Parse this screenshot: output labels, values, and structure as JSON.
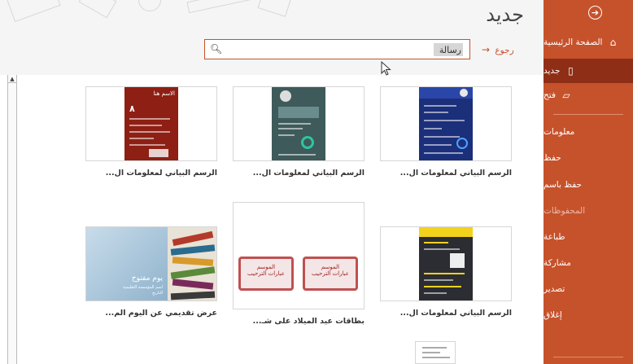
{
  "page": {
    "title": "جديد",
    "back_label": "رجوع"
  },
  "search": {
    "value": "رسالة"
  },
  "sidebar": {
    "items": [
      {
        "label": "الصفحة الرئيسية",
        "icon": "home-icon"
      },
      {
        "label": "جديد",
        "icon": "new-file-icon"
      },
      {
        "label": "فتح",
        "icon": "open-folder-icon"
      },
      {
        "label": "معلومات"
      },
      {
        "label": "حفظ"
      },
      {
        "label": "حفظ باسم"
      },
      {
        "label": "المحفوظات"
      },
      {
        "label": "طباعة"
      },
      {
        "label": "مشاركة"
      },
      {
        "label": "تصدير"
      },
      {
        "label": "إغلاق"
      }
    ]
  },
  "templates": [
    {
      "label": "الرسم البياني لمعلومات ال...",
      "thumb_text": ""
    },
    {
      "label": "الرسم البياني لمعلومات ال..."
    },
    {
      "label": "الرسم البياني لمعلومات ال...",
      "thumb_title": "الاسم هنا",
      "thumb_number": "٨"
    },
    {
      "label": "الرسم البياني لمعلومات ال..."
    },
    {
      "label": "بطاقات عيد الميلاد على شـ...",
      "card_title": "الموسم",
      "card_subtitle": "عبارات الترحيب"
    },
    {
      "label": "عرض تقديمي عن اليوم الم...",
      "slide_title": "يوم مفتوح",
      "slide_sub": "اسم المؤسسة التعليمية",
      "slide_sub2": "التاريخ"
    }
  ],
  "colors": {
    "accent": "#c6522b",
    "accent_dark": "#8f2e17"
  }
}
